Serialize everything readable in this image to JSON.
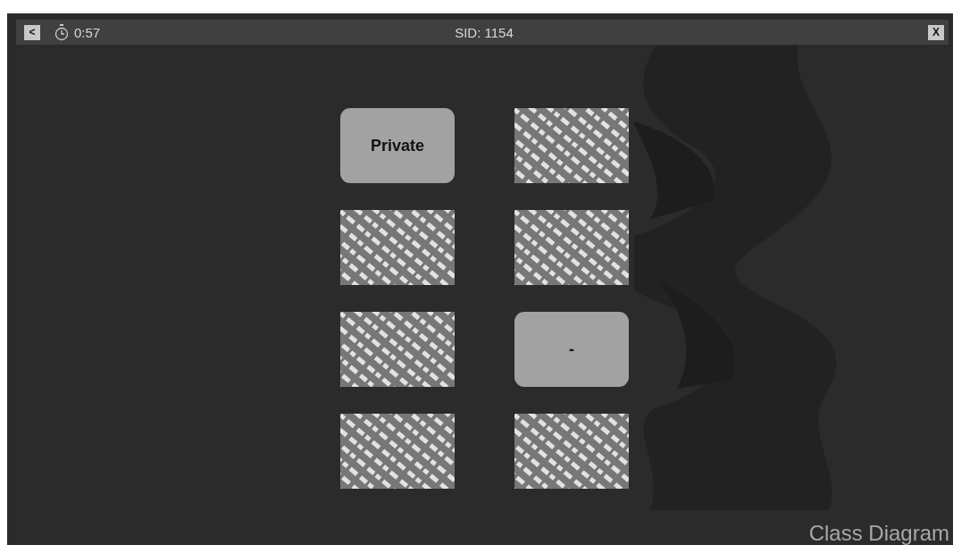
{
  "top_bar": {
    "back_button": "<",
    "timer": "0:57",
    "session": "SID: 1154",
    "close_button": "X"
  },
  "cards": [
    {
      "revealed": true,
      "label": "Private"
    },
    {
      "revealed": false
    },
    {
      "revealed": false
    },
    {
      "revealed": false
    },
    {
      "revealed": false
    },
    {
      "revealed": true,
      "label": "-"
    },
    {
      "revealed": false
    },
    {
      "revealed": false
    }
  ],
  "topic": "Class Diagram"
}
